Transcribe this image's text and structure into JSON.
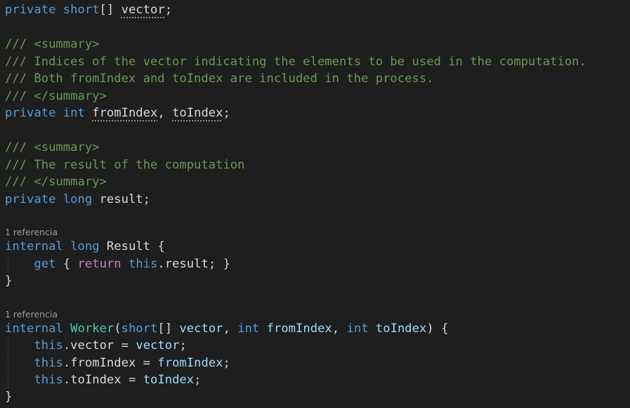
{
  "lines": {
    "l1": {
      "k": "private",
      "t": "short",
      "b": "[]",
      "v": "vector",
      "e": ";"
    },
    "l3": "/// <summary>",
    "l4": "/// Indices of the vector indicating the elements to be used in the computation.",
    "l5": "/// Both fromIndex and toIndex are included in the process.",
    "l6": "/// </summary>",
    "l7": {
      "k1": "private",
      "k2": "int",
      "v1": "fromIndex",
      "c": ",",
      "v2": "toIndex",
      "e": ";"
    },
    "l9": "/// <summary>",
    "l10": "/// The result of the computation",
    "l11": "/// </summary>",
    "l12": {
      "k1": "private",
      "k2": "long",
      "v": "result",
      "e": ";"
    },
    "cl1": "1 referencia",
    "l14": {
      "k1": "internal",
      "k2": "long",
      "n": "Result",
      "o": "{"
    },
    "l15": {
      "g": "get",
      "o": "{",
      "r": "return",
      "th": "this",
      "d": ".",
      "f": "result",
      "s": ";",
      "c": "}"
    },
    "l16": "}",
    "cl2": "1 referencia",
    "l18": {
      "k1": "internal",
      "ctor": "Worker",
      "p1": "(",
      "t1": "short",
      "b": "[]",
      "a1": "vector",
      "c1": ",",
      "t2": "int",
      "a2": "fromIndex",
      "c2": ",",
      "t3": "int",
      "a3": "toIndex",
      "p2": ")",
      "o": "{"
    },
    "l19": {
      "th": "this",
      "d": ".",
      "f": "vector",
      "eq": "=",
      "v": "vector",
      "s": ";"
    },
    "l20": {
      "th": "this",
      "d": ".",
      "f": "fromIndex",
      "eq": "=",
      "v": "fromIndex",
      "s": ";"
    },
    "l21": {
      "th": "this",
      "d": ".",
      "f": "toIndex",
      "eq": "=",
      "v": "toIndex",
      "s": ";"
    },
    "l22": "}"
  },
  "colors": {
    "background": "#1e1e1e",
    "keyword": "#569cd6",
    "control_keyword": "#c586c0",
    "type_name": "#4ec9b0",
    "comment": "#6a9955",
    "parameter": "#9cdcfe",
    "codelens": "#999999"
  }
}
